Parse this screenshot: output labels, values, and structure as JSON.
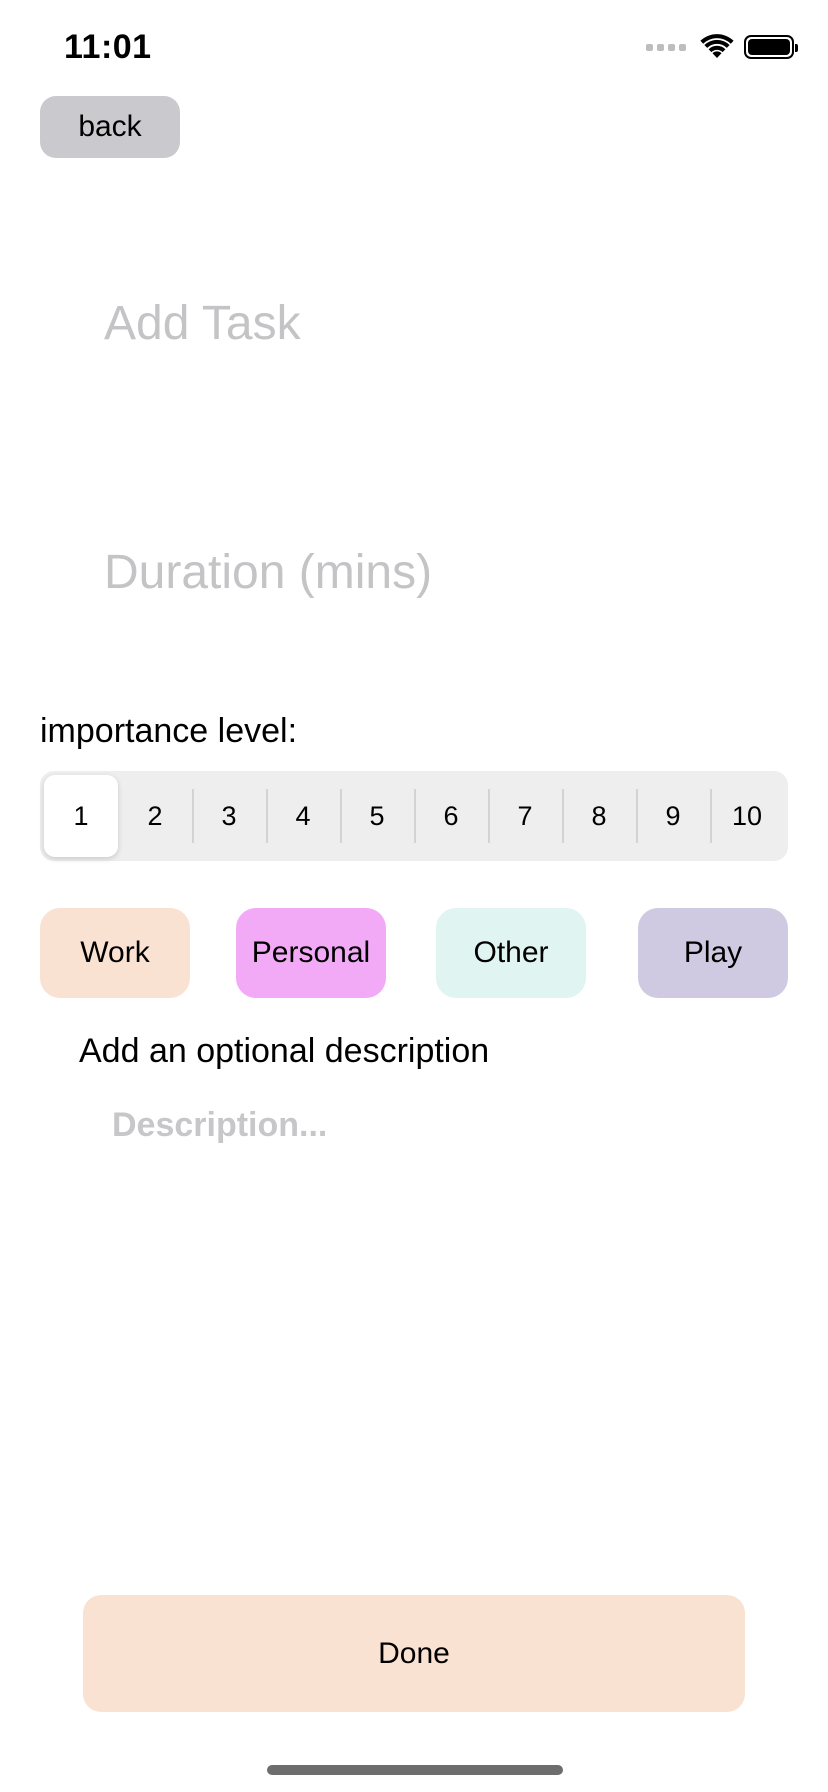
{
  "status_bar": {
    "time": "11:01",
    "icons": [
      "signal-icon",
      "wifi-icon",
      "battery-icon"
    ]
  },
  "back_button": {
    "label": "back",
    "color": "#c9c9ce"
  },
  "task_input": {
    "placeholder": "Add Task",
    "value": ""
  },
  "duration_input": {
    "placeholder": "Duration (mins)",
    "value": ""
  },
  "importance": {
    "label": "importance level:",
    "options": [
      "1",
      "2",
      "3",
      "4",
      "5",
      "6",
      "7",
      "8",
      "9",
      "10"
    ],
    "selected": "1"
  },
  "categories": [
    {
      "label": "Work",
      "color": "#fae2d3"
    },
    {
      "label": "Personal",
      "color": "#f2aaf6"
    },
    {
      "label": "Other",
      "color": "#e0f4f2"
    },
    {
      "label": "Play",
      "color": "#cfcae1"
    }
  ],
  "description": {
    "heading": "Add an optional description",
    "placeholder": "Description...",
    "value": ""
  },
  "done_button": {
    "label": "Done",
    "color": "#fae2d3"
  }
}
